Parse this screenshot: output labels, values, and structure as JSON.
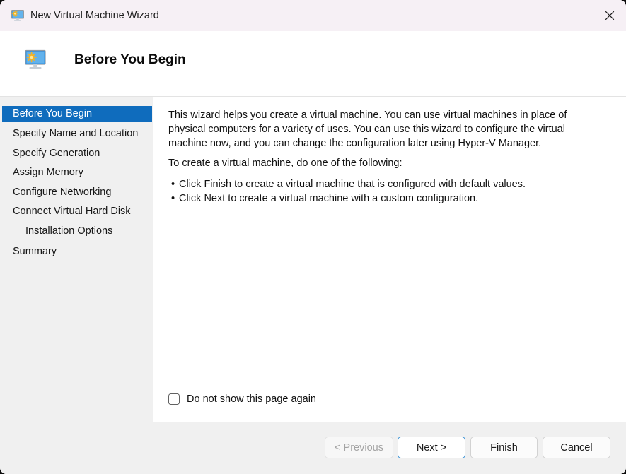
{
  "window": {
    "title": "New Virtual Machine Wizard",
    "title_icon": "virtual-machine-monitor-icon",
    "close_icon": "close-icon",
    "accent_color": "#0f6cbd",
    "titlebar_color": "#f6f0f5",
    "sidebar_color": "#f0f0f0"
  },
  "header": {
    "title": "Before You Begin",
    "icon": "virtual-machine-monitor-icon"
  },
  "sidebar": {
    "items": [
      {
        "label": "Before You Begin",
        "selected": true,
        "indented": false
      },
      {
        "label": "Specify Name and Location",
        "selected": false,
        "indented": false
      },
      {
        "label": "Specify Generation",
        "selected": false,
        "indented": false
      },
      {
        "label": "Assign Memory",
        "selected": false,
        "indented": false
      },
      {
        "label": "Configure Networking",
        "selected": false,
        "indented": false
      },
      {
        "label": "Connect Virtual Hard Disk",
        "selected": false,
        "indented": false
      },
      {
        "label": "Installation Options",
        "selected": false,
        "indented": true
      },
      {
        "label": "Summary",
        "selected": false,
        "indented": false
      }
    ]
  },
  "content": {
    "intro_paragraph": "This wizard helps you create a virtual machine. You can use virtual machines in place of physical computers for a variety of uses. You can use this wizard to configure the virtual machine now, and you can change the configuration later using Hyper-V Manager.",
    "lead_in": "To create a virtual machine, do one of the following:",
    "bullets": [
      "Click Finish to create a virtual machine that is configured with default values.",
      "Click Next to create a virtual machine with a custom configuration."
    ],
    "checkbox": {
      "label": "Do not show this page again",
      "checked": false
    }
  },
  "footer": {
    "buttons": [
      {
        "label": "< Previous",
        "state": "disabled"
      },
      {
        "label": "Next >",
        "state": "default"
      },
      {
        "label": "Finish",
        "state": "normal"
      },
      {
        "label": "Cancel",
        "state": "normal"
      }
    ]
  }
}
